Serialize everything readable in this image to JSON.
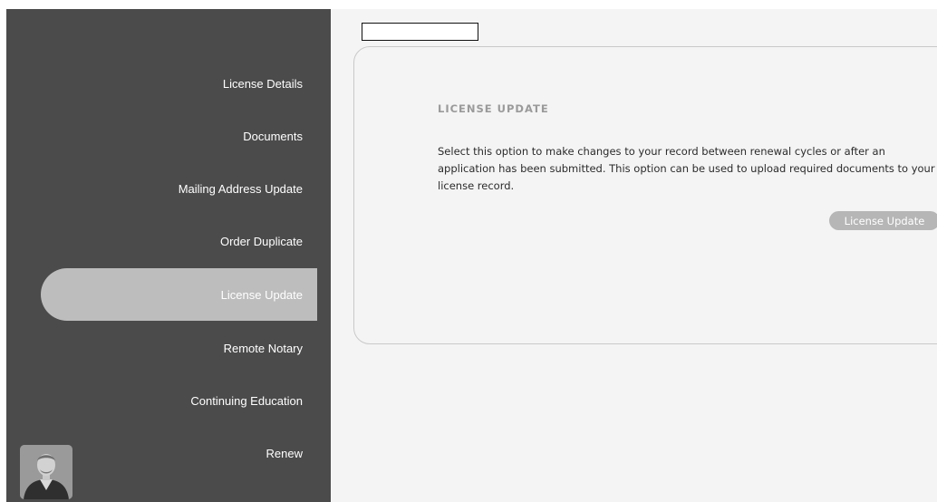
{
  "sidebar": {
    "items": [
      {
        "label": "License Details"
      },
      {
        "label": "Documents"
      },
      {
        "label": "Mailing Address Update"
      },
      {
        "label": "Order Duplicate"
      },
      {
        "label": "License Update"
      },
      {
        "label": "Remote Notary"
      },
      {
        "label": "Continuing Education"
      },
      {
        "label": "Renew"
      }
    ],
    "active_item": "License Update",
    "avatar_icon": "user-avatar-icon"
  },
  "card": {
    "title": "LICENSE UPDATE",
    "description": "Select this option to make changes to your record between renewal cycles or after an application has been submitted. This option can be used to upload required documents to your license record.",
    "button_label": "License Update"
  },
  "colors": {
    "sidebar_bg": "#4b4b4b",
    "active_item_bg": "#bdbdbd",
    "main_bg": "#f4f4f4",
    "button_bg": "#b6b6b6"
  }
}
